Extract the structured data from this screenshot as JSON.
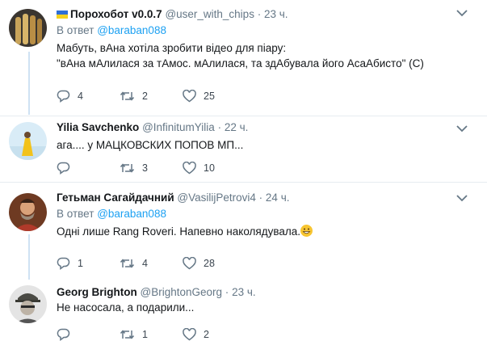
{
  "tweets": [
    {
      "name": "Порохобот v0.0.7",
      "handle": "@user_with_chips",
      "time": "23 ч.",
      "reply_prefix": "В ответ",
      "reply_to": "@baraban088",
      "lines": [
        "Мабуть, вАна хотіла зробити відео для піару:",
        "\"вАна мАлилася за тАмос. мАлилася, та здАбувала його АсаАбисто\" (С)"
      ],
      "replies": "4",
      "retweets": "2",
      "likes": "25"
    },
    {
      "name": "Yilia Savchenko",
      "handle": "@InfinitumYilia",
      "time": "22 ч.",
      "lines": [
        "ага.... у МАЦКОВСКИХ ПОПОВ МП..."
      ],
      "replies": "",
      "retweets": "3",
      "likes": "10"
    },
    {
      "name": "Гетьман Сагайдачний",
      "handle": "@VasilijPetrovi4",
      "time": "24 ч.",
      "reply_prefix": "В ответ",
      "reply_to": "@baraban088",
      "lines": [
        "Одні лише Rang Roveri. Напевно наколядувала."
      ],
      "replies": "1",
      "retweets": "4",
      "likes": "28"
    },
    {
      "name": "Georg Brighton",
      "handle": "@BrightonGeorg",
      "time": "23 ч.",
      "lines": [
        "Не насосала, а подарили..."
      ],
      "replies": "",
      "retweets": "1",
      "likes": "2"
    }
  ],
  "separator": "·",
  "icons": {
    "reply": "reply-icon",
    "retweet": "retweet-icon",
    "like": "heart-icon",
    "menu": "chevron-down-icon"
  },
  "colors": {
    "link": "#1da1f2",
    "muted": "#657786",
    "border": "#e6ecf0",
    "thread": "#cfe2f3"
  }
}
